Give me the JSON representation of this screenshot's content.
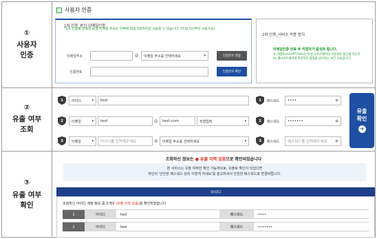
{
  "rows": [
    {
      "num": "①",
      "line1": "사용자",
      "line2": "인증"
    },
    {
      "num": "②",
      "line1": "유출 여부",
      "line2": "조회"
    },
    {
      "num": "③",
      "line1": "유출 여부",
      "line2": "확인"
    }
  ],
  "auth": {
    "header": "사용자 인증",
    "step1_title": "1차 인증_본인 이메일인증",
    "step1_note": "*1차 인증을 완료한 동일 이메일 주소는 하루에 최대 3회까지만 사용할 수 있습니다. (익일 0시부터 사용가능)",
    "email_label": "이메일주소",
    "at": "@",
    "domain_placeholder": "이메일 주소를 선택하세요",
    "send_button": "인증번호 발송",
    "code_label": "인증번호",
    "confirm_button": "인증번호 확인",
    "step2_title": "2차 인증_서비스 악용 방지",
    "step2_notice": "이메일인증 완료 후 리캡차가 활성화 됩니다.",
    "step2_note": "※ 리캡차(reCAPTCHA)는 악성 소프트웨어의 자동화된 접근을 차단하여, 웹사이트에서의 악의적인 활동을 방지하는 보안 기술입니다."
  },
  "lookup": {
    "rows": [
      {
        "n": "1",
        "type": "아이디",
        "value": "test",
        "pw_label": "패스워드",
        "pw": "••••",
        "n2": "1"
      },
      {
        "n": "2",
        "type": "이메일",
        "value": "test",
        "at": "@",
        "domain": "test.com",
        "domain_select": "직접입력",
        "pw_label": "패스워드",
        "pw": "•••••••",
        "n2": "2"
      },
      {
        "n": "3",
        "type": "이메일",
        "value_placeholder": "아이디를 입력해주세요",
        "at": "@",
        "domain_placeholder": "이메일 주소를 선택하세요",
        "pw_label": "패스워드",
        "pw_placeholder": "패스워드를 입력해주세요",
        "n2": "3"
      }
    ],
    "button_line1": "유출",
    "button_line2": "확인"
  },
  "result": {
    "title_pre": "조회하신 정보는",
    "title_badge": "유출 이력 있음",
    "title_post": "으로 확인되었습니다",
    "info_line1": "본 서비스는 유출 여부만 확인 가능하므로, 유출로 확인이 되었다면",
    "info_line2": "하단의 '안전한 패스워드 관리 이렇게 하세요'를 참고하셔서 안전한 패스워드로 변경바랍니다.",
    "tab": "아이디",
    "summary_pre": "조회하신 아이디 계정 정보 중 2개의",
    "summary_badge": "(유출 이력 있음)",
    "summary_post": "을 확인하였습니다",
    "table": [
      {
        "n": "1",
        "col": "아이디",
        "value": "test",
        "pw_label": "패스워드",
        "pw": "••••"
      },
      {
        "n": "2",
        "col": "아이디",
        "value": "test",
        "pw_label": "패스워드",
        "pw": "•••••••"
      }
    ]
  },
  "colors": {
    "accent": "#1d4fa3",
    "green": "#1a9a2e",
    "red": "#d9261c",
    "shield": "#3a3a3a"
  }
}
